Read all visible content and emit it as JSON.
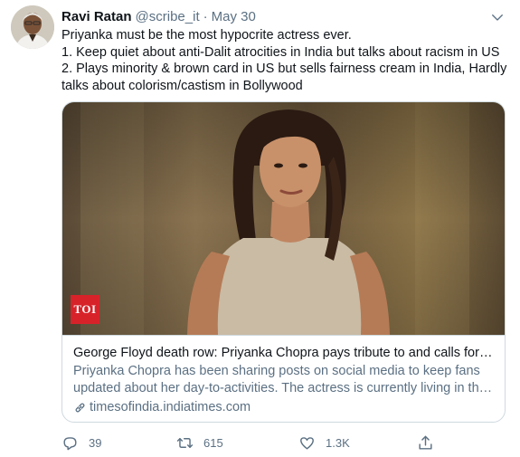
{
  "tweet": {
    "author_name": "Ravi Ratan",
    "handle": "@scribe_it",
    "separator": "·",
    "date": "May 30",
    "lines": [
      "Priyanka must be the most hypocrite actress ever.",
      "1. Keep quiet about anti-Dalit atrocities in India but talks about racism in US",
      "2. Plays minority & brown card in US but sells fairness cream in India, Hardly",
      "talks about colorism/castism in Bollywood"
    ]
  },
  "card": {
    "badge": "TOI",
    "title": "George Floyd death row: Priyanka Chopra pays tribute to and calls for ju...",
    "description_lines": [
      "Priyanka Chopra has been sharing posts on social media to keep fans",
      "updated about her day-to-activities. The actress is currently living in the..."
    ],
    "domain": "timesofindia.indiatimes.com"
  },
  "actions": {
    "reply_count": "39",
    "retweet_count": "615",
    "like_count": "1.3K"
  },
  "icons": {
    "caret": "chevron-down-icon",
    "reply": "reply-icon",
    "retweet": "retweet-icon",
    "like": "heart-icon",
    "share": "share-icon",
    "link": "link-icon"
  },
  "colors": {
    "text_primary": "#0f1419",
    "text_secondary": "#5b7083",
    "border": "#cfd9de",
    "toi_red": "#d8222a"
  }
}
